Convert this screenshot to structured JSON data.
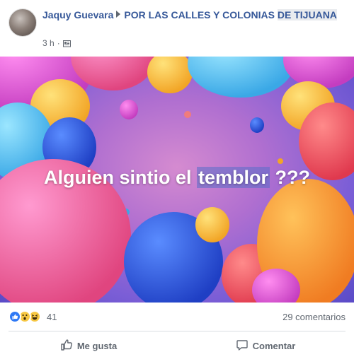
{
  "post": {
    "author": "Jaquy Guevara",
    "group_prefix": "POR LAS CALLES Y COLONIAS",
    "group_tag": "DE TIJUANA",
    "time": "3 h",
    "separator": "·",
    "privacy_icon": "group-icon"
  },
  "hero": {
    "text_before": "Alguien sintio el",
    "text_tagged": "temblor",
    "text_after": "???"
  },
  "reactions": {
    "icons": [
      "like-icon",
      "wow-icon",
      "haha-icon"
    ],
    "count": "41",
    "comments": "29 comentarios"
  },
  "actions": {
    "like_label": "Me gusta",
    "comment_label": "Comentar"
  },
  "colors": {
    "link": "#365899",
    "secondary": "#606770",
    "like_blue": "#2e79f5"
  }
}
